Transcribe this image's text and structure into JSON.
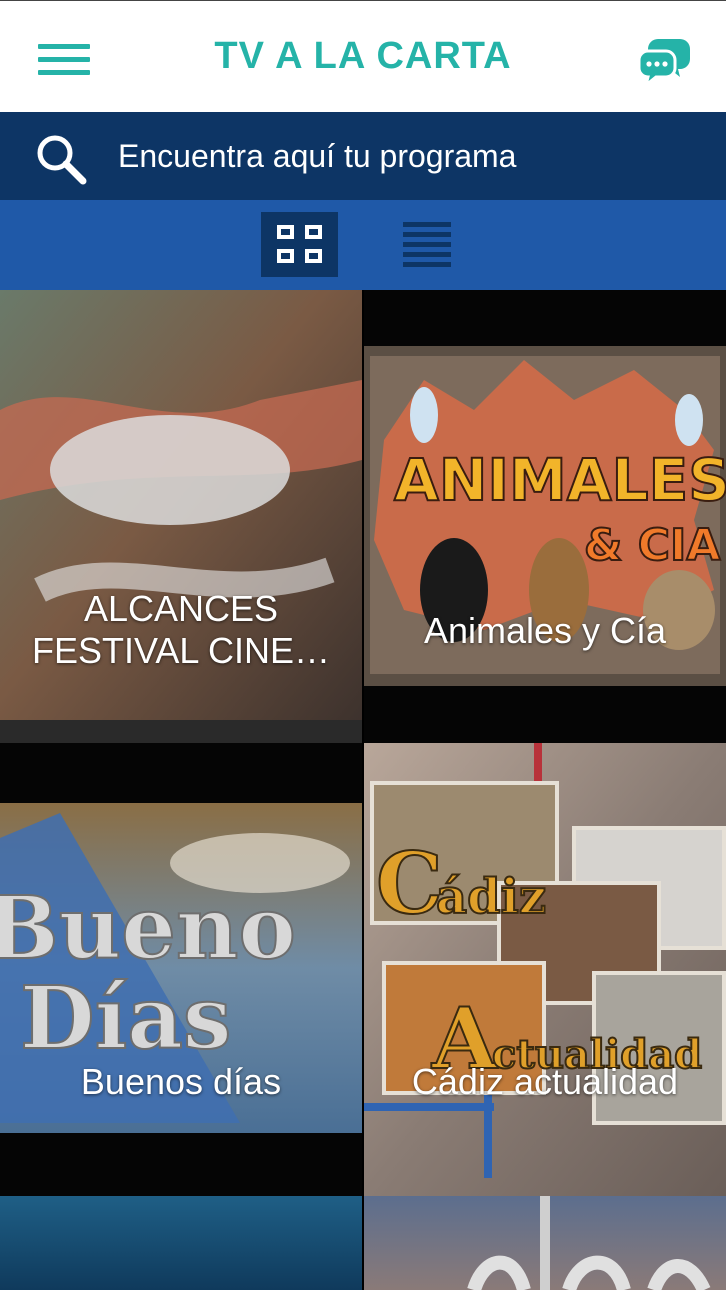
{
  "header": {
    "title": "TV A LA CARTA",
    "accent_color": "#25b3a8",
    "menu_icon": "hamburger-menu-icon",
    "chat_icon": "chat-bubbles-icon"
  },
  "search": {
    "placeholder": "Encuentra aquí tu programa",
    "icon": "search-icon",
    "background_color": "#0d3565"
  },
  "view_toggle": {
    "background_color": "#1f59a8",
    "selected": "grid",
    "options": [
      "grid",
      "list"
    ]
  },
  "programs": [
    {
      "label": "ALCANCES FESTIVAL CINE…"
    },
    {
      "label": "Animales y Cía"
    },
    {
      "label": "Buenos días"
    },
    {
      "label": "Cádiz actualidad"
    },
    {
      "label": ""
    },
    {
      "label": ""
    }
  ]
}
